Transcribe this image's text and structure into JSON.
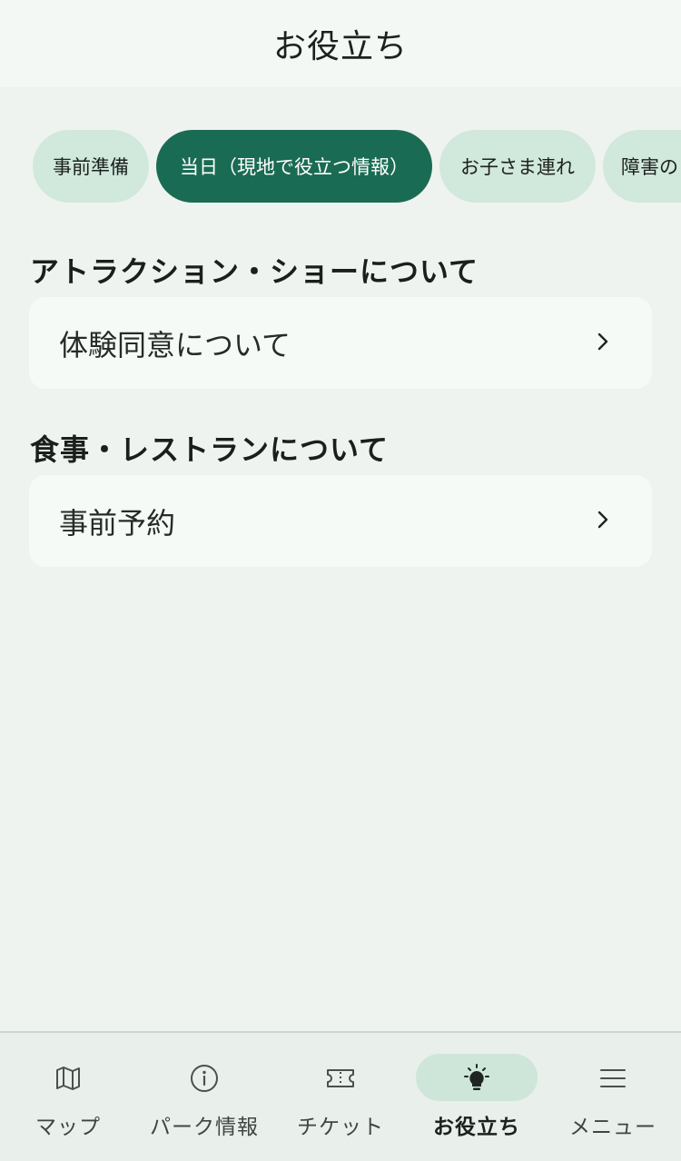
{
  "header": {
    "title": "お役立ち"
  },
  "chips": [
    {
      "label": "事前準備",
      "active": false
    },
    {
      "label": "当日（現地で役立つ情報）",
      "active": true
    },
    {
      "label": "お子さま連れ",
      "active": false
    },
    {
      "label": "障害の",
      "active": false
    }
  ],
  "sections": [
    {
      "heading": "アトラクション・ショーについて",
      "items": [
        {
          "label": "体験同意について"
        }
      ]
    },
    {
      "heading": "食事・レストランについて",
      "items": [
        {
          "label": "事前予約"
        }
      ]
    }
  ],
  "tabbar": {
    "items": [
      {
        "label": "マップ",
        "icon": "map-icon",
        "active": false
      },
      {
        "label": "パーク情報",
        "icon": "info-icon",
        "active": false
      },
      {
        "label": "チケット",
        "icon": "ticket-icon",
        "active": false
      },
      {
        "label": "お役立ち",
        "icon": "lightbulb-icon",
        "active": true
      },
      {
        "label": "メニュー",
        "icon": "menu-icon",
        "active": false
      }
    ]
  },
  "colors": {
    "accent": "#1a6b53",
    "chip_bg": "#d1e8dc",
    "active_tab_pill": "#cde6d9",
    "background": "#eff3ef"
  }
}
